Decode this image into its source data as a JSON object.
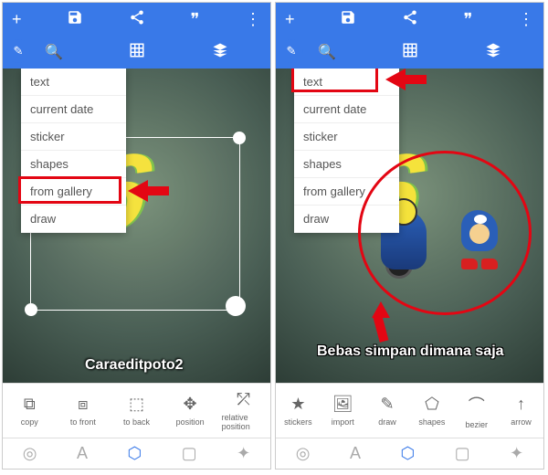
{
  "toolbar": {
    "new_icon": "+",
    "save_icon": "💾",
    "share_icon": "share",
    "quote_icon": "❞",
    "menu_icon": "⋮"
  },
  "subtoolbar": {
    "edit_icon": "✎",
    "zoom_icon": "🔍",
    "grid_icon": "⊞",
    "layers_icon": "layers"
  },
  "dropdown": {
    "items": [
      "text",
      "current date",
      "sticker",
      "shapes",
      "from gallery",
      "draw"
    ]
  },
  "canvas": {
    "number_graphic": "46",
    "caption_right": "Bebas simpan dimana saja",
    "watermark": "Caraeditpoto2"
  },
  "bottom_tools_left": [
    {
      "icon": "⧉",
      "label": "copy"
    },
    {
      "icon": "⧈",
      "label": "to front"
    },
    {
      "icon": "⬚",
      "label": "to back"
    },
    {
      "icon": "✥",
      "label": "position"
    },
    {
      "icon": "⤱",
      "label": "relative position"
    }
  ],
  "bottom_tools_right": [
    {
      "icon": "★",
      "label": "stickers"
    },
    {
      "icon": "🖼",
      "label": "import"
    },
    {
      "icon": "✎",
      "label": "draw"
    },
    {
      "icon": "⬠",
      "label": "shapes"
    },
    {
      "icon": "⌒",
      "label": "bezier"
    },
    {
      "icon": "↑",
      "label": "arrow"
    }
  ],
  "annotations": {
    "highlight_left": "from gallery",
    "highlight_right": "text"
  }
}
